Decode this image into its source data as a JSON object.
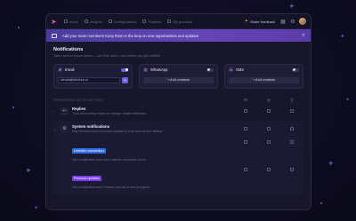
{
  "nav": {
    "tabs": [
      "Inbox",
      "Insights",
      "Configurations",
      "Timeline",
      "My products"
    ],
    "feedback_label": "Share feedback"
  },
  "banner": {
    "text": "Add your team members! Keep them in the loop on new opportunities and updates"
  },
  "page": {
    "title": "Notifications",
    "subtitle": "Take control of your alerts — set how, when, and where you get notified"
  },
  "channels": [
    {
      "name": "Email",
      "enabled": true,
      "value": "olenah@shortza.co"
    },
    {
      "name": "WhatsApp",
      "enabled": false,
      "button": "+ Add contacts"
    },
    {
      "name": "SMS",
      "enabled": false,
      "button": "+ Add contacts"
    }
  ],
  "preferences": {
    "header": "PREFERRED NOTIFICATIONS",
    "items": [
      {
        "title": "Replies",
        "description": "Track all incoming replies to manage contact effectively"
      },
      {
        "title": "System notifications",
        "description": "Stay informed about important updates to your account and settings"
      }
    ],
    "sub_items": [
      {
        "tag": "Linkedin connection",
        "description": "Get a notification when your LinkedIn connection is lost"
      },
      {
        "tag": "Persona updates",
        "description": "Get a notification when Shortza runs out of new prospects"
      }
    ]
  },
  "colors": {
    "accent": "#6c5ce7",
    "banner": "#5a3ca8",
    "tag_blue": "#2f6fe0",
    "tag_purple": "#7c3aed"
  }
}
